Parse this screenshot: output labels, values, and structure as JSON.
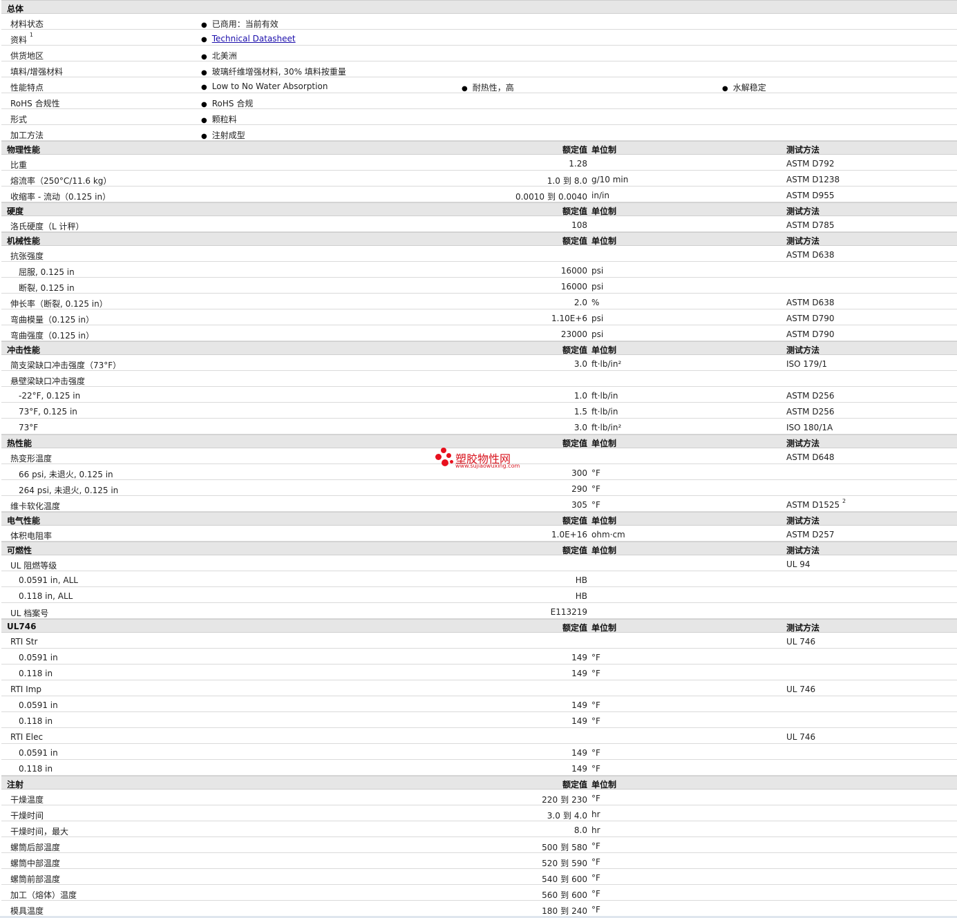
{
  "headers": {
    "value": "额定值",
    "unit": "单位制",
    "method": "测试方法"
  },
  "general": {
    "title": "总体",
    "status_label": "材料状态",
    "status_value": "已商用：当前有效",
    "docs_label": "资料",
    "docs_sup": "1",
    "docs_link": "Technical Datasheet",
    "region_label": "供货地区",
    "region_value": "北美洲",
    "filler_label": "填料/增强材料",
    "filler_value": "玻璃纤维增强材料, 30% 填料按重量",
    "feature_label": "性能特点",
    "features": [
      "Low to No Water Absorption",
      "耐热性，高",
      "水解稳定"
    ],
    "rohs_label": "RoHS 合规性",
    "rohs_value": "RoHS 合规",
    "form_label": "形式",
    "form_value": "颗粒料",
    "process_label": "加工方法",
    "process_value": "注射成型"
  },
  "physical": {
    "title": "物理性能",
    "rows": [
      {
        "label": "比重",
        "value": "1.28",
        "unit": "",
        "method": "ASTM D792"
      },
      {
        "label": "熔流率（250°C/11.6 kg）",
        "v1": "1.0",
        "to": "到",
        "v2": "8.0",
        "unit": "g/10 min",
        "method": "ASTM D1238"
      },
      {
        "label": "收缩率 - 流动（0.125 in）",
        "v1": "0.0010",
        "to": "到",
        "v2": "0.0040",
        "unit": "in/in",
        "method": "ASTM D955"
      }
    ]
  },
  "hardness": {
    "title": "硬度",
    "rows": [
      {
        "label": "洛氏硬度（L 计秤）",
        "value": "108",
        "method": "ASTM D785"
      }
    ]
  },
  "mechanical": {
    "title": "机械性能",
    "rows": [
      {
        "label": "抗张强度",
        "method": "ASTM D638"
      },
      {
        "label": "屈服, 0.125 in",
        "value": "16000",
        "unit": "psi"
      },
      {
        "label": "断裂, 0.125 in",
        "value": "16000",
        "unit": "psi"
      },
      {
        "label": "伸长率（断裂, 0.125 in）",
        "value": "2.0",
        "unit": "%",
        "method": "ASTM D638"
      },
      {
        "label": "弯曲模量（0.125 in）",
        "value": "1.10E+6",
        "unit": "psi",
        "method": "ASTM D790"
      },
      {
        "label": "弯曲强度（0.125 in）",
        "value": "23000",
        "unit": "psi",
        "method": "ASTM D790"
      }
    ]
  },
  "impact": {
    "title": "冲击性能",
    "rows": [
      {
        "label": "简支梁缺口冲击强度（73°F）",
        "value": "3.0",
        "unit": "ft·lb/in²",
        "method": "ISO 179/1"
      },
      {
        "label": "悬壁梁缺口冲击强度"
      },
      {
        "label": "-22°F, 0.125 in",
        "value": "1.0",
        "unit": "ft·lb/in",
        "method": "ASTM D256"
      },
      {
        "label": "73°F, 0.125 in",
        "value": "1.5",
        "unit": "ft·lb/in",
        "method": "ASTM D256"
      },
      {
        "label": "73°F",
        "value": "3.0",
        "unit": "ft·lb/in²",
        "method": "ISO 180/1A"
      }
    ]
  },
  "thermal": {
    "title": "热性能",
    "rows": [
      {
        "label": "热变形温度",
        "method": "ASTM D648"
      },
      {
        "label": "66 psi, 未退火, 0.125 in",
        "value": "300",
        "unit": "°F"
      },
      {
        "label": "264 psi, 未退火, 0.125 in",
        "value": "290",
        "unit": "°F"
      },
      {
        "label": "维卡软化温度",
        "value": "305",
        "unit": "°F",
        "method": "ASTM D1525",
        "sup": "2"
      }
    ]
  },
  "electrical": {
    "title": "电气性能",
    "rows": [
      {
        "label": "体积电阻率",
        "value": "1.0E+16",
        "unit": "ohm·cm",
        "method": "ASTM D257"
      }
    ]
  },
  "flammability": {
    "title": "可燃性",
    "rows": [
      {
        "label": "UL 阻燃等级",
        "method": "UL 94"
      },
      {
        "label": "0.0591 in, ALL",
        "value": "HB"
      },
      {
        "label": "0.118 in, ALL",
        "value": "HB"
      },
      {
        "label": "UL 档案号",
        "value": "E113219"
      }
    ]
  },
  "ul746": {
    "title": "UL746",
    "rows": [
      {
        "label": "RTI Str",
        "method": "UL 746"
      },
      {
        "label": "0.0591 in",
        "value": "149",
        "unit": "°F"
      },
      {
        "label": "0.118 in",
        "value": "149",
        "unit": "°F"
      },
      {
        "label": "RTI Imp",
        "method": "UL 746"
      },
      {
        "label": "0.0591 in",
        "value": "149",
        "unit": "°F"
      },
      {
        "label": "0.118 in",
        "value": "149",
        "unit": "°F"
      },
      {
        "label": "RTI Elec",
        "method": "UL 746"
      },
      {
        "label": "0.0591 in",
        "value": "149",
        "unit": "°F"
      },
      {
        "label": "0.118 in",
        "value": "149",
        "unit": "°F"
      }
    ]
  },
  "injection": {
    "title": "注射",
    "rows": [
      {
        "label": "干燥温度",
        "v1": "220",
        "to": "到",
        "v2": "230",
        "unit": "°F"
      },
      {
        "label": "干燥时间",
        "v1": "3.0",
        "to": "到",
        "v2": "4.0",
        "unit": "hr"
      },
      {
        "label": "干燥时间，最大",
        "value": "8.0",
        "unit": "hr"
      },
      {
        "label": "螺筒后部温度",
        "v1": "500",
        "to": "到",
        "v2": "580",
        "unit": "°F"
      },
      {
        "label": "螺筒中部温度",
        "v1": "520",
        "to": "到",
        "v2": "590",
        "unit": "°F"
      },
      {
        "label": "螺筒前部温度",
        "v1": "540",
        "to": "到",
        "v2": "600",
        "unit": "°F"
      },
      {
        "label": "加工（熔体）温度",
        "v1": "560",
        "to": "到",
        "v2": "600",
        "unit": "°F"
      },
      {
        "label": "模具温度",
        "v1": "180",
        "to": "到",
        "v2": "240",
        "unit": "°F"
      }
    ]
  },
  "watermark": {
    "title": "塑胶物性网",
    "url": "www.sujiaowuxing.com"
  },
  "colors": {
    "section_bg": "#e6e6e6",
    "link": "#1a0dab",
    "watermark": "#d8141e"
  }
}
